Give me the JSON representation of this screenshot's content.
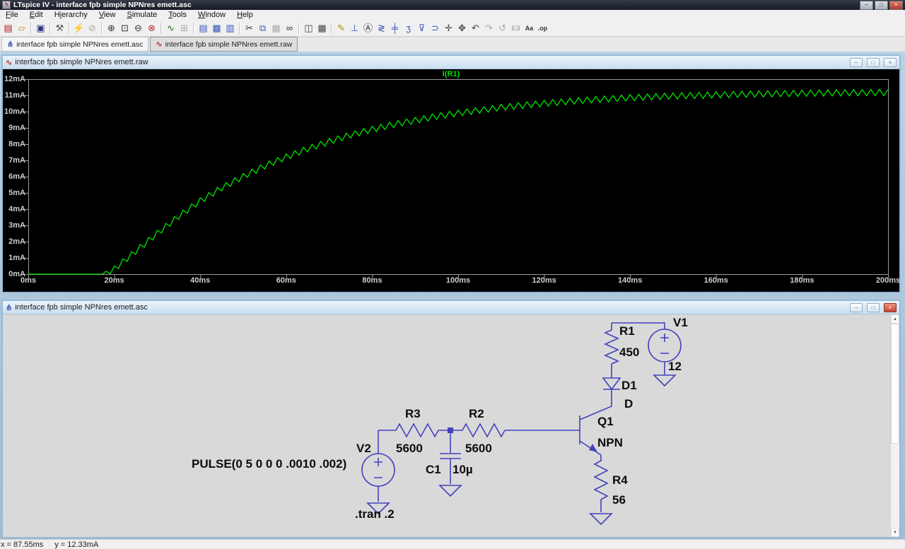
{
  "colors": {
    "trace_green": "#00e400",
    "wire_blue": "#4343bd",
    "axis_text": "#cfcfcf",
    "titlebar_dark": "#1c2029"
  },
  "window": {
    "title": "LTspice IV - interface fpb simple NPNres emett.asc",
    "icon_glyph": "ϟ",
    "controls": {
      "minimize": "–",
      "maximize": "□",
      "close": "×"
    }
  },
  "child_controls": {
    "minimize": "–",
    "restore": "□",
    "close": "×"
  },
  "ui": {
    "scroll_up": "▲",
    "scroll_down": "▼"
  },
  "menu": {
    "items": [
      {
        "label": "File",
        "accel": 0
      },
      {
        "label": "Edit",
        "accel": 0
      },
      {
        "label": "Hierarchy",
        "accel": 1
      },
      {
        "label": "View",
        "accel": 0
      },
      {
        "label": "Simulate",
        "accel": 0
      },
      {
        "label": "Tools",
        "accel": 0
      },
      {
        "label": "Window",
        "accel": 0
      },
      {
        "label": "Help",
        "accel": 0
      }
    ]
  },
  "toolbar": {
    "groups": [
      [
        {
          "name": "new-schematic-button",
          "glyph": "▤",
          "color": "#b02020",
          "enabled": true
        },
        {
          "name": "open-file-button",
          "glyph": "▱",
          "color": "#c08828",
          "enabled": true
        }
      ],
      [
        {
          "name": "save-button",
          "glyph": "▣",
          "color": "#26337d",
          "enabled": true
        }
      ],
      [
        {
          "name": "control-panel-button",
          "glyph": "⚒",
          "color": "#5a5a5a",
          "enabled": true
        }
      ],
      [
        {
          "name": "run-button",
          "glyph": "⚡",
          "color": "#7a4a10",
          "enabled": true
        },
        {
          "name": "halt-button",
          "glyph": "⊘",
          "color": "#888888",
          "enabled": false
        }
      ],
      [
        {
          "name": "zoom-in-button",
          "glyph": "⊕",
          "color": "#333333",
          "enabled": true
        },
        {
          "name": "zoom-area-button",
          "glyph": "⊡",
          "color": "#333333",
          "enabled": true
        },
        {
          "name": "zoom-out-button",
          "glyph": "⊖",
          "color": "#333333",
          "enabled": true
        },
        {
          "name": "zoom-full-extents-button",
          "glyph": "⊗",
          "color": "#b03030",
          "enabled": true
        }
      ],
      [
        {
          "name": "plot-settings-button",
          "glyph": "∿",
          "color": "#1f7a1f",
          "enabled": true
        },
        {
          "name": "autorange-button",
          "glyph": "⊞",
          "color": "#888888",
          "enabled": false
        }
      ],
      [
        {
          "name": "tile-horizontal-button",
          "glyph": "▤",
          "color": "#3a55b8",
          "enabled": true
        },
        {
          "name": "cascade-button",
          "glyph": "▩",
          "color": "#3a55b8",
          "enabled": true
        },
        {
          "name": "tile-vertical-button",
          "glyph": "▥",
          "color": "#3a55b8",
          "enabled": true
        }
      ],
      [
        {
          "name": "cut-button",
          "glyph": "✂",
          "color": "#333333",
          "enabled": true
        },
        {
          "name": "copy-button",
          "glyph": "⧉",
          "color": "#3a55b8",
          "enabled": true
        },
        {
          "name": "paste-button",
          "glyph": "▦",
          "color": "#888888",
          "enabled": false
        },
        {
          "name": "find-button",
          "glyph": "∞",
          "color": "#333333",
          "enabled": true
        }
      ],
      [
        {
          "name": "print-preview-button",
          "glyph": "◫",
          "color": "#444444",
          "enabled": true
        },
        {
          "name": "print-button",
          "glyph": "▦",
          "color": "#444444",
          "enabled": true
        }
      ],
      [
        {
          "name": "wire-button",
          "glyph": "✎",
          "color": "#b89000",
          "enabled": true
        },
        {
          "name": "ground-button",
          "glyph": "⊥",
          "color": "#3a55b8",
          "enabled": true
        },
        {
          "name": "net-label-button",
          "glyph": "Ⓐ",
          "color": "#333333",
          "enabled": true
        },
        {
          "name": "resistor-button",
          "glyph": "≷",
          "color": "#3a55b8",
          "enabled": true
        },
        {
          "name": "capacitor-button",
          "glyph": "╪",
          "color": "#3a55b8",
          "enabled": true
        },
        {
          "name": "inductor-button",
          "glyph": "ʒ",
          "color": "#3a55b8",
          "enabled": true
        },
        {
          "name": "diode-button",
          "glyph": "⊽",
          "color": "#3a55b8",
          "enabled": true
        },
        {
          "name": "component-button",
          "glyph": "⊃",
          "color": "#3a55b8",
          "enabled": true
        },
        {
          "name": "move-button",
          "glyph": "✛",
          "color": "#444444",
          "enabled": true
        },
        {
          "name": "drag-button",
          "glyph": "✥",
          "color": "#444444",
          "enabled": true
        },
        {
          "name": "undo-button",
          "glyph": "↶",
          "color": "#444444",
          "enabled": true
        },
        {
          "name": "redo-button",
          "glyph": "↷",
          "color": "#888888",
          "enabled": false
        },
        {
          "name": "rotate-button",
          "glyph": "↺",
          "color": "#888888",
          "enabled": false
        },
        {
          "name": "mirror-button",
          "glyph": "EƎ",
          "color": "#888888",
          "enabled": false
        },
        {
          "name": "text-button",
          "glyph": "Aa",
          "color": "#333333",
          "enabled": true
        },
        {
          "name": "spice-directive-button",
          "glyph": ".op",
          "color": "#333333",
          "enabled": true
        }
      ]
    ]
  },
  "tabs": [
    {
      "label": "interface fpb simple NPNres emett.asc",
      "glyph": "⋔",
      "active": true
    },
    {
      "label": "interface fpb simple NPNres emett.raw",
      "glyph": "∿",
      "active": false
    }
  ],
  "plot_window": {
    "title": "interface fpb simple NPNres emett.raw",
    "icon_glyph": "∿"
  },
  "chart_data": {
    "type": "line",
    "title": "",
    "legend_position": "top-center",
    "grid": false,
    "background": "#000000",
    "x": {
      "label_unit": "ms",
      "min": 0,
      "max": 200,
      "ticks": [
        "0ms",
        "20ms",
        "40ms",
        "60ms",
        "80ms",
        "100ms",
        "120ms",
        "140ms",
        "160ms",
        "180ms",
        "200ms"
      ]
    },
    "y": {
      "label_unit": "mA",
      "min": 0,
      "max": 12,
      "ticks": [
        "0mA",
        "1mA",
        "2mA",
        "3mA",
        "4mA",
        "5mA",
        "6mA",
        "7mA",
        "8mA",
        "9mA",
        "10mA",
        "11mA",
        "12mA"
      ]
    },
    "series": [
      {
        "name": "I(R1)",
        "color": "#00e400",
        "shape": "exponential rise with 2ms sawtooth ripple, flat at 0 until ~17ms",
        "envelope_points": [
          [
            0,
            0
          ],
          [
            17,
            0
          ],
          [
            20,
            0.5
          ],
          [
            25,
            1.6
          ],
          [
            30,
            2.7
          ],
          [
            35,
            3.75
          ],
          [
            40,
            4.7
          ],
          [
            45,
            5.5
          ],
          [
            50,
            6.2
          ],
          [
            55,
            6.85
          ],
          [
            60,
            7.4
          ],
          [
            65,
            7.9
          ],
          [
            70,
            8.35
          ],
          [
            75,
            8.75
          ],
          [
            80,
            9.1
          ],
          [
            85,
            9.4
          ],
          [
            90,
            9.65
          ],
          [
            95,
            9.9
          ],
          [
            100,
            10.1
          ],
          [
            110,
            10.45
          ],
          [
            120,
            10.7
          ],
          [
            130,
            10.9
          ],
          [
            140,
            11.05
          ],
          [
            150,
            11.15
          ],
          [
            160,
            11.22
          ],
          [
            170,
            11.28
          ],
          [
            180,
            11.32
          ],
          [
            190,
            11.35
          ],
          [
            200,
            11.37
          ]
        ],
        "ripple": {
          "period_ms": 2,
          "amplitude_mA": 0.38,
          "rise_fraction": 0.5
        }
      }
    ]
  },
  "schematic": {
    "title": "interface fpb simple NPNres emett.asc",
    "icon_glyph": "⋔",
    "components": [
      {
        "ref": "V1",
        "value": "12"
      },
      {
        "ref": "R1",
        "value": "450"
      },
      {
        "ref": "D1",
        "value": "D"
      },
      {
        "ref": "Q1",
        "value": "NPN"
      },
      {
        "ref": "R4",
        "value": "56"
      },
      {
        "ref": "R3",
        "value": "5600"
      },
      {
        "ref": "R2",
        "value": "5600"
      },
      {
        "ref": "C1",
        "value": "10µ"
      },
      {
        "ref": "V2",
        "value": "PULSE(0 5 0 0 0 .0010 .002)"
      }
    ],
    "directive": ".tran .2"
  },
  "status": {
    "x": "x = 87.55ms",
    "y": "y = 12.33mA"
  }
}
